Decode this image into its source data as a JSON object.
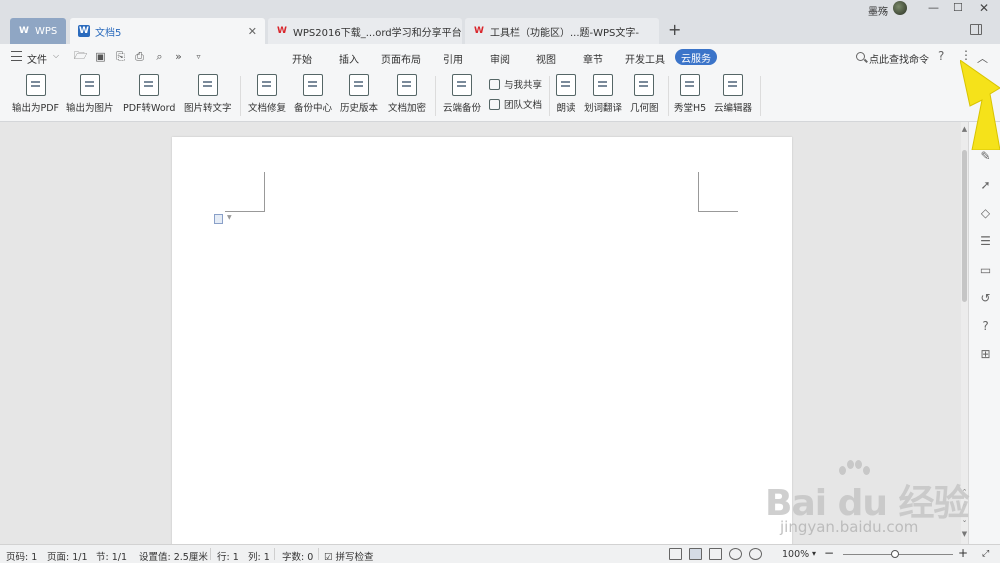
{
  "titlebar": {
    "tabs": [
      {
        "label": "WPS",
        "icon": "wps-logo-icon"
      },
      {
        "label": "文档5",
        "icon": "document-icon"
      },
      {
        "label": "WPS2016下载_...ord学习和分享平台",
        "icon": "wps-red-icon"
      },
      {
        "label": "工具栏（功能区）...题-WPS文字-",
        "icon": "wps-red-icon"
      }
    ],
    "new_tab": "+",
    "user_name": "墨殇",
    "min": "—",
    "max": "☐",
    "close": "✕"
  },
  "menubar": {
    "file": "文件",
    "tabs": [
      "开始",
      "插入",
      "页面布局",
      "引用",
      "审阅",
      "视图",
      "章节",
      "开发工具"
    ],
    "active_tab": "云服务",
    "search": "点此查找命令",
    "help": "?",
    "more": "⋮",
    "collapse": "︿"
  },
  "ribbon": {
    "buttons": [
      "输出为PDF",
      "输出为图片",
      "PDF转Word",
      "图片转文字",
      "文档修复",
      "备份中心",
      "历史版本",
      "文档加密",
      "云端备份"
    ],
    "small_buttons": [
      "与我共享",
      "团队文档"
    ],
    "buttons2": [
      "朗读",
      "划词翻译",
      "几何图",
      "秀堂H5",
      "云编辑器"
    ]
  },
  "statusbar": {
    "page_no": "页码: 1",
    "pages": "页面: 1/1",
    "section": "节: 1/1",
    "setting": "设置值: 2.5厘米",
    "row": "行: 1",
    "col": "列: 1",
    "chars": "字数: 0",
    "spell": "拼写检查",
    "zoom": "100%",
    "zoom_out": "−",
    "zoom_in": "+"
  },
  "watermark": {
    "brand": "Bai du 经验",
    "url": "jingyan.baidu.com"
  },
  "colors": {
    "accent": "#3b74c9",
    "tab_active_text": "#2b6bbd",
    "wps_red": "#d9262c",
    "pointer": "#f5e21a"
  }
}
